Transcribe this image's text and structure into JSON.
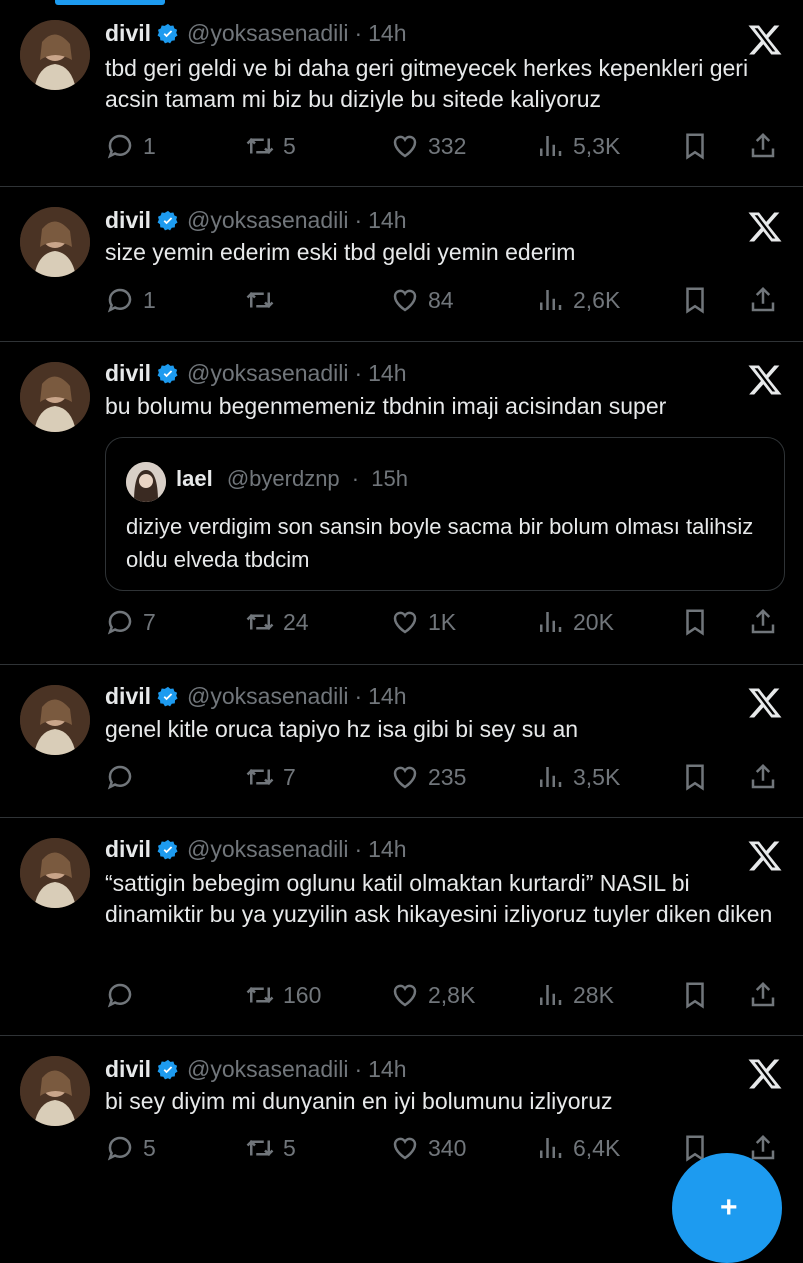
{
  "tweets": [
    {
      "name": "divil",
      "handle": "@yoksasenadili",
      "time": "14h",
      "text": "tbd geri geldi ve bi daha geri gitmeyecek herkes kepenkleri geri acsin tamam mi biz bu diziyle bu sitede kaliyoruz",
      "replies": "1",
      "retweets": "5",
      "likes": "332",
      "views": "5,3K"
    },
    {
      "name": "divil",
      "handle": "@yoksasenadili",
      "time": "14h",
      "text": "size yemin ederim eski tbd geldi yemin ederim",
      "replies": "1",
      "retweets": "",
      "likes": "84",
      "views": "2,6K"
    },
    {
      "name": "divil",
      "handle": "@yoksasenadili",
      "time": "14h",
      "text": "bu bolumu begenmemeniz tbdnin imaji acisindan super",
      "quote": {
        "name": "lael",
        "handle": "@byerdznp",
        "time": "15h",
        "text": "diziye verdigim son sansin boyle sacma bir bolum olması talihsiz oldu elveda tbdcim"
      },
      "replies": "7",
      "retweets": "24",
      "likes": "1K",
      "views": "20K"
    },
    {
      "name": "divil",
      "handle": "@yoksasenadili",
      "time": "14h",
      "text": "genel kitle oruca tapiyo hz isa gibi bi sey su an",
      "replies": "",
      "retweets": "7",
      "likes": "235",
      "views": "3,5K"
    },
    {
      "name": "divil",
      "handle": "@yoksasenadili",
      "time": "14h",
      "text": "“sattigin bebegim oglunu katil olmaktan kurtardi” NASIL bi dinamiktir bu ya yuzyilin ask hikayesini izliyoruz tuyler diken diken",
      "replies": "",
      "retweets": "160",
      "likes": "2,8K",
      "views": "28K"
    },
    {
      "name": "divil",
      "handle": "@yoksasenadili",
      "time": "14h",
      "text": "bi sey diyim mi dunyanin en iyi bolumunu izliyoruz",
      "replies": "5",
      "retweets": "5",
      "likes": "340",
      "views": "6,4K"
    }
  ],
  "dot": "·",
  "colors": {
    "background": "#000000",
    "text": "#e7e9ea",
    "muted": "#71767b",
    "accent": "#1d9bf0",
    "divider": "#2f3336"
  },
  "icons": [
    "verified-badge-icon",
    "x-logo-icon",
    "reply-icon",
    "retweet-icon",
    "like-icon",
    "views-icon",
    "bookmark-icon",
    "share-icon",
    "compose-fab"
  ]
}
